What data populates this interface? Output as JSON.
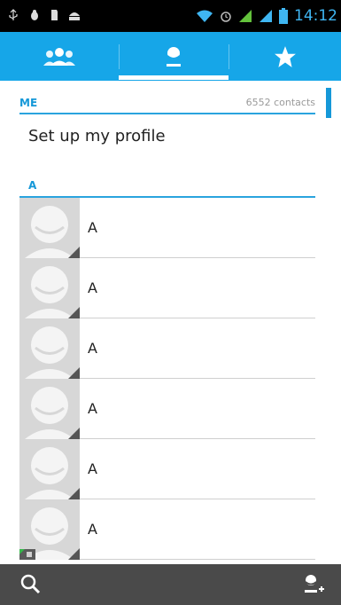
{
  "status_bar": {
    "time": "14:12",
    "icons": [
      "usb-icon",
      "bug-icon",
      "sd-card-icon",
      "android-icon",
      "wifi-icon",
      "alarm-icon",
      "signal-icon",
      "signal-icon",
      "battery-icon"
    ]
  },
  "tabs": [
    {
      "name": "groups",
      "icon": "people-icon"
    },
    {
      "name": "all-contacts",
      "icon": "person-icon",
      "selected": true
    },
    {
      "name": "favorites",
      "icon": "star-icon"
    }
  ],
  "me_section": {
    "label": "ME",
    "count": "6552 contacts",
    "setup_profile": "Set up my profile"
  },
  "section_letter": "A",
  "contacts": [
    {
      "name": "A"
    },
    {
      "name": "A"
    },
    {
      "name": "A"
    },
    {
      "name": "A"
    },
    {
      "name": "A"
    },
    {
      "name": "A"
    }
  ],
  "bottom_bar": {
    "left_icon": "search-icon",
    "right_icon": "add-contact-icon"
  },
  "colors": {
    "accent": "#16a6e8",
    "status_bar_bg": "#000000",
    "bottom_bar_bg": "#4a4a4a",
    "avatar_bg": "#d7d7d7"
  }
}
